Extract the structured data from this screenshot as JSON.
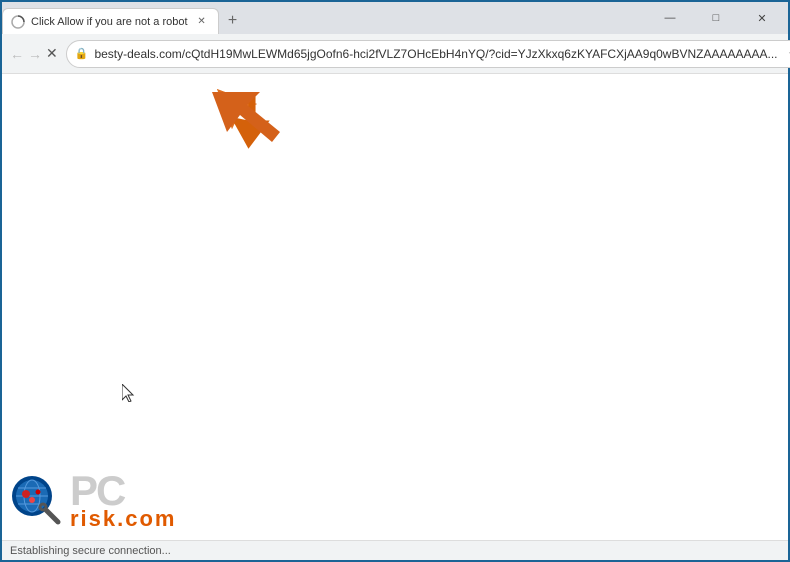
{
  "window": {
    "border_color": "#1a6496"
  },
  "titlebar": {
    "tab": {
      "title": "Click Allow if you are not a robot",
      "favicon_color": "#1a73e8"
    },
    "new_tab_label": "+",
    "controls": {
      "minimize": "—",
      "maximize": "□",
      "close": "✕"
    }
  },
  "toolbar": {
    "back_icon": "←",
    "forward_icon": "→",
    "reload_icon": "✕",
    "address": "besty-deals.com/cQtdH19MwLEWMd65jgOofn6-hci2fVLZ7OHcEbH4nYQ/?cid=YJzXkxq6zKYAFCXjAA9q0wBVNZAAAAAAAA...",
    "bookmark_icon": "☆",
    "profile_icon": "person",
    "menu_icon": "⋮"
  },
  "page": {
    "background": "#ffffff",
    "arrow": {
      "color": "#e06010",
      "direction": "upper-left"
    }
  },
  "statusbar": {
    "text": "Establishing secure connection..."
  },
  "pcrisk": {
    "pc_text": "PC",
    "risk_text": "risk.com"
  }
}
